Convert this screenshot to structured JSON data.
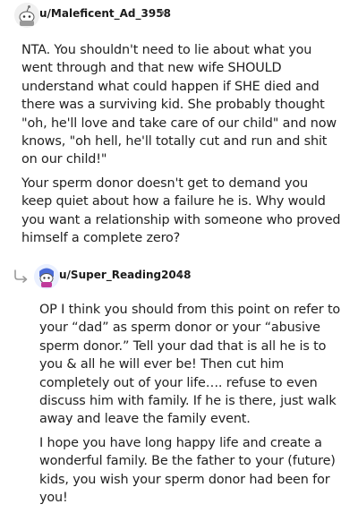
{
  "comments": [
    {
      "username": "u/Maleficent_Ad_3958",
      "separator": "•",
      "avatar_icon": "snoo-avatar-icon",
      "paragraphs": [
        "NTA. You shouldn't need to lie about what you went through and that new wife SHOULD understand what could happen if SHE died and there was a surviving kid. She probably thought \"oh, he'll love and take care of our child\" and now knows, \"oh hell, he'll totally cut and run and shit on our child!\"",
        "Your sperm donor doesn't get to demand you keep quiet about how a failure he is. Why would you want a relationship with someone who proved himself a complete zero?"
      ]
    },
    {
      "username": "u/Super_Reading2048",
      "separator": "•",
      "avatar_icon": "snoo-avatar-icon",
      "reply_icon": "reply-arrow-icon",
      "paragraphs": [
        "OP I think you should from this point on refer to your “dad” as sperm donor or your “abusive sperm donor.” Tell your dad that is all he is to you & all he will ever be! Then cut him completely out of your life…. refuse to even discuss him with family. If he is there, just walk away and leave the family event.",
        "I hope you have long happy life and create a wonderful family. Be the father to your (future) kids, you wish your sperm donor had been for you!"
      ]
    }
  ]
}
